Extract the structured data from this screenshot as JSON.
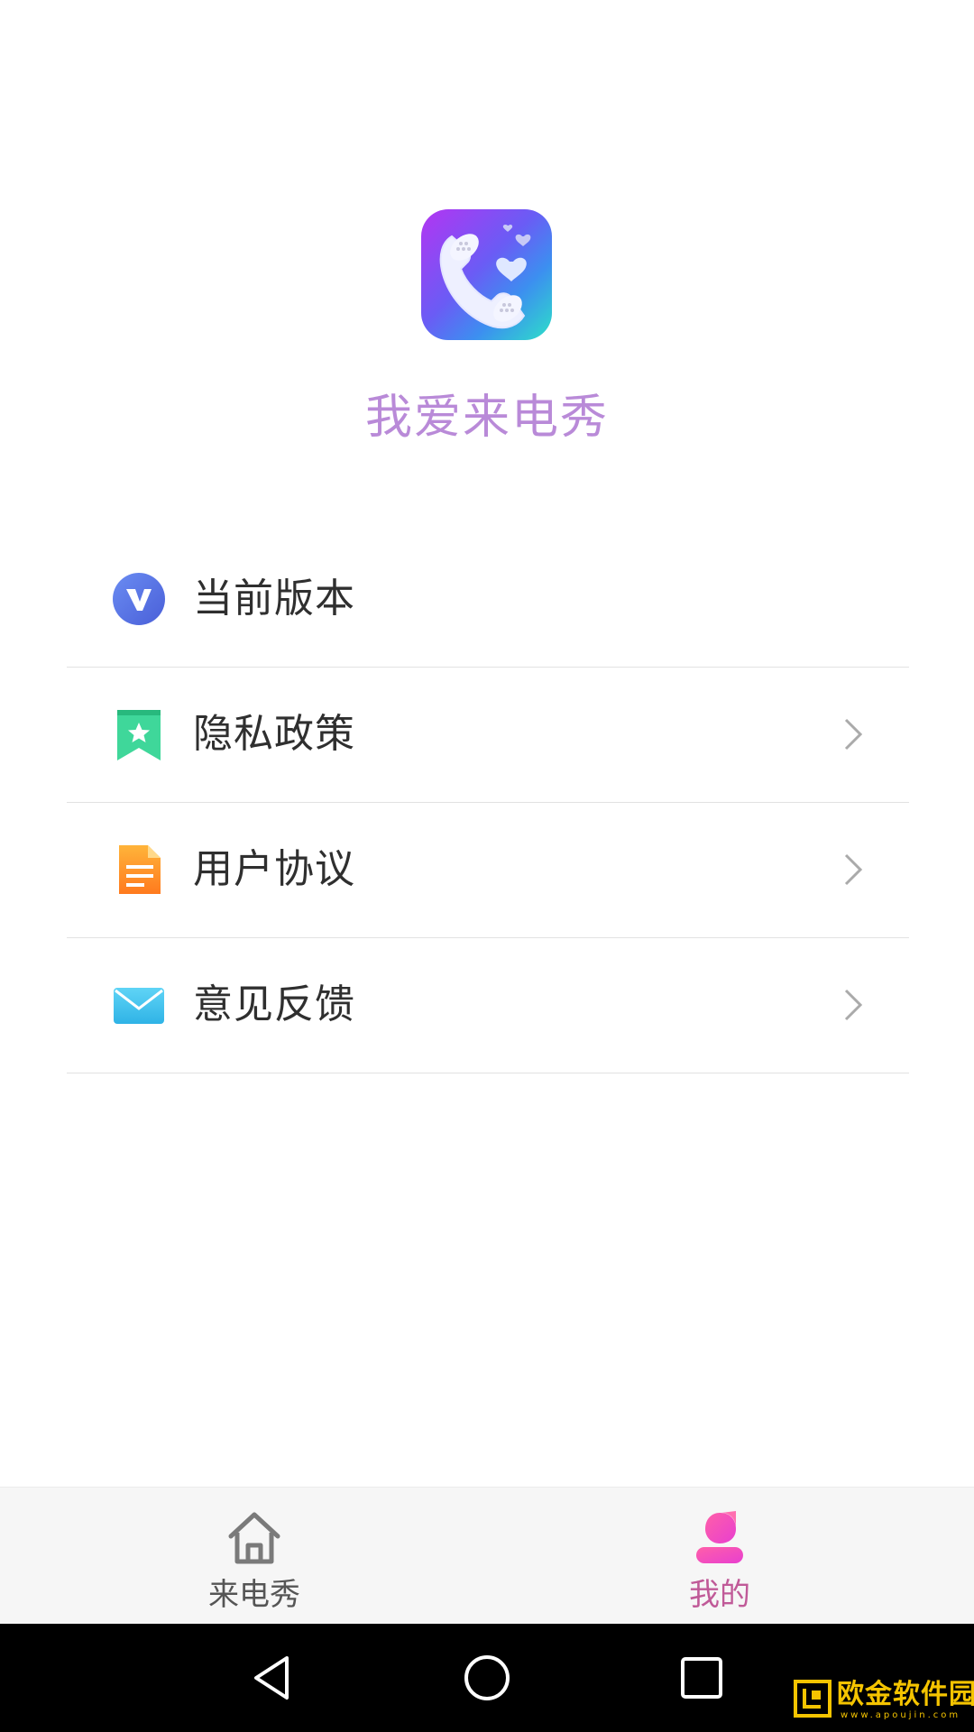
{
  "header": {
    "app_name": "我爱来电秀",
    "logo_icon": "phone-hearts-icon"
  },
  "menu": {
    "items": [
      {
        "label": "当前版本",
        "icon": "v-badge-icon",
        "icon_color": "#5b7be8",
        "has_chevron": false
      },
      {
        "label": "隐私政策",
        "icon": "bookmark-star-icon",
        "icon_color": "#3fd79a",
        "has_chevron": true
      },
      {
        "label": "用户协议",
        "icon": "document-icon",
        "icon_color": "#ff9a2a",
        "has_chevron": true
      },
      {
        "label": "意见反馈",
        "icon": "mail-icon",
        "icon_color": "#3ec3ee",
        "has_chevron": true
      }
    ]
  },
  "bottom_nav": {
    "tabs": [
      {
        "label": "来电秀",
        "icon": "home-icon",
        "active": false
      },
      {
        "label": "我的",
        "icon": "profile-icon",
        "active": true
      }
    ],
    "active_color": "#e83fc0"
  },
  "system_bar": {
    "buttons": [
      "back-icon",
      "home-circle-icon",
      "recent-apps-icon"
    ]
  },
  "watermark": {
    "text": "欧金软件园",
    "url_text": "www.apoujin.com"
  }
}
